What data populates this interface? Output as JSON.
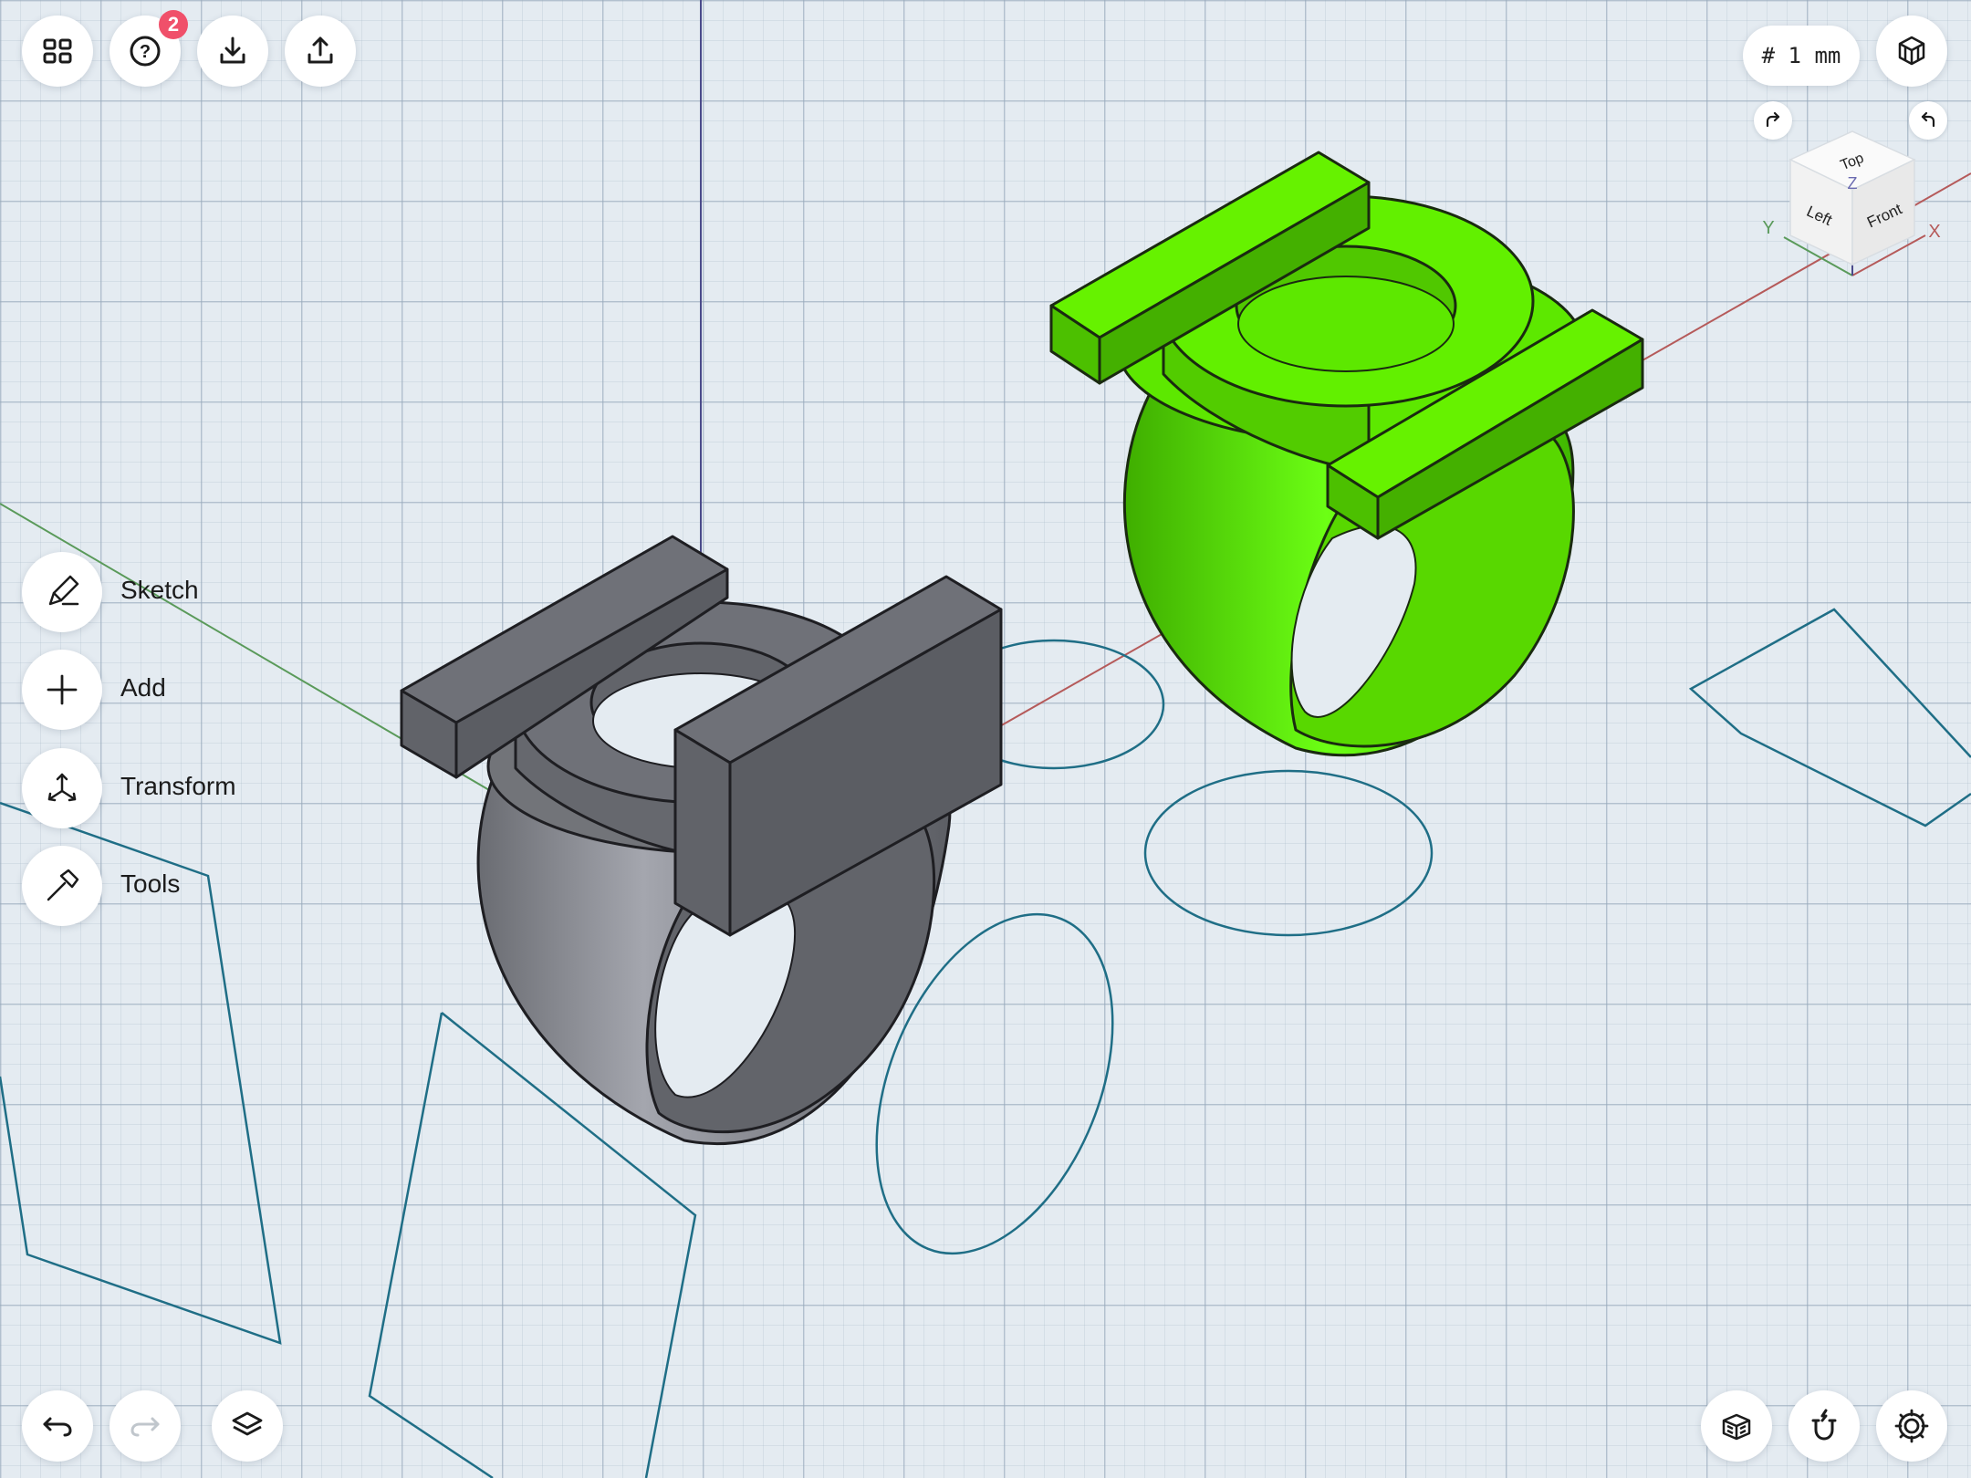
{
  "toolbar_top_left": {
    "help_badge_count": "2",
    "icons": [
      "grid-icon",
      "help-icon",
      "import-icon",
      "export-icon"
    ]
  },
  "toolbar_top_right": {
    "grid_size_label": "# 1 mm",
    "view_icon": "cube-view-icon"
  },
  "view_cube": {
    "top_label": "Top",
    "left_label": "Left",
    "front_label": "Front",
    "axis_x": "X",
    "axis_y": "Y",
    "axis_z": "Z"
  },
  "side_menu": {
    "items": [
      {
        "label": "Sketch",
        "icon": "pencil-icon"
      },
      {
        "label": "Add",
        "icon": "plus-icon"
      },
      {
        "label": "Transform",
        "icon": "transform-arrows-icon"
      },
      {
        "label": "Tools",
        "icon": "hammer-icon"
      }
    ]
  },
  "bottom_left": {
    "icons": [
      "undo-icon",
      "redo-icon",
      "layers-icon"
    ]
  },
  "bottom_right": {
    "icons": [
      "section-view-icon",
      "snap-magnet-icon",
      "settings-gear-icon"
    ]
  },
  "colors": {
    "selected_body": "#5ce600",
    "body": "#6f7178",
    "sketch_line": "#1f6e86",
    "axis_x": "#b55a5a",
    "axis_y": "#5a9a5a",
    "axis_z": "#4a4a8a",
    "badge": "#f0506a"
  }
}
